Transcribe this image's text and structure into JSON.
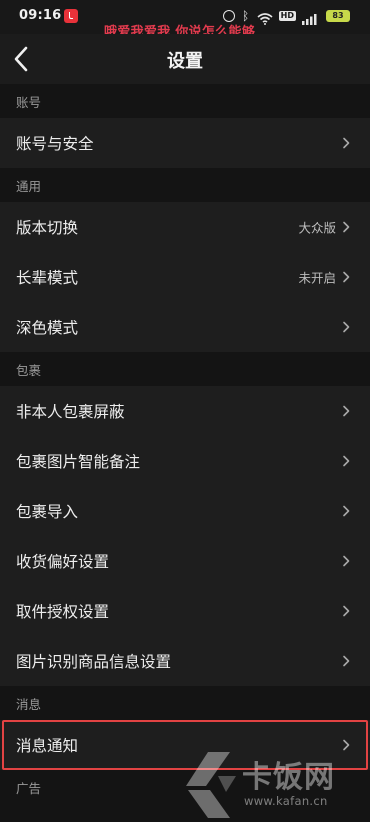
{
  "status_bar": {
    "time": "09:16",
    "overlay_caption": "哦爱我爱我 你说怎么能够",
    "network_badge": "HD",
    "battery": "83",
    "icons": [
      "app-notification-icon",
      "alarm-icon",
      "bluetooth-icon",
      "wifi-icon",
      "signal-icon",
      "battery-icon"
    ]
  },
  "header": {
    "back_icon": "chevron-left-icon",
    "title": "设置"
  },
  "sections": [
    {
      "header": "账号",
      "items": [
        {
          "label": "账号与安全",
          "value": ""
        }
      ]
    },
    {
      "header": "通用",
      "items": [
        {
          "label": "版本切换",
          "value": "大众版"
        },
        {
          "label": "长辈模式",
          "value": "未开启"
        },
        {
          "label": "深色模式",
          "value": ""
        }
      ]
    },
    {
      "header": "包裹",
      "items": [
        {
          "label": "非本人包裹屏蔽",
          "value": ""
        },
        {
          "label": "包裹图片智能备注",
          "value": ""
        },
        {
          "label": "包裹导入",
          "value": ""
        },
        {
          "label": "收货偏好设置",
          "value": ""
        },
        {
          "label": "取件授权设置",
          "value": ""
        },
        {
          "label": "图片识别商品信息设置",
          "value": ""
        }
      ]
    },
    {
      "header": "消息",
      "items": [
        {
          "label": "消息通知",
          "value": "",
          "highlighted": true
        }
      ]
    },
    {
      "header": "广告",
      "items": []
    }
  ],
  "watermark": {
    "name": "卡饭网",
    "url": "www.kafan.cn"
  },
  "colors": {
    "background": "#141414",
    "row_background": "#1e1e1e",
    "highlight_border": "#e24343",
    "caption": "#e23b4e",
    "battery": "#c7d94a"
  }
}
